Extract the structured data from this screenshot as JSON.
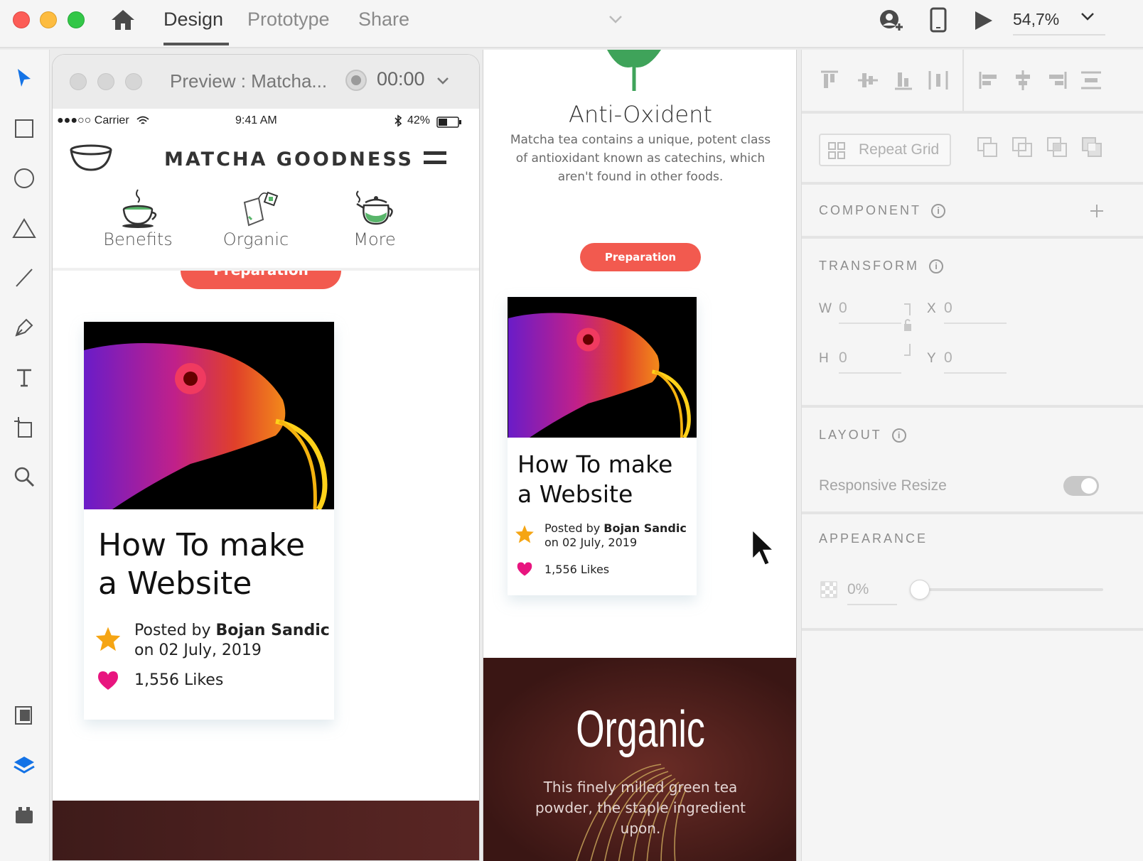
{
  "topbar": {
    "tabs": [
      "Design",
      "Prototype",
      "Share"
    ],
    "active_tab": "Design",
    "zoom": "54,7%"
  },
  "preview": {
    "title": "Preview : Matcha...",
    "timer": "00:00",
    "status": {
      "carrier": "●●●○○ Carrier",
      "time": "9:41 AM",
      "battery": "42%"
    },
    "brand": "MATCHA GOODNESS",
    "nav": [
      "Benefits",
      "Organic",
      "More"
    ],
    "prep_button": "Preparation",
    "card": {
      "title_line1": "How To make",
      "title_line2": "a Website",
      "posted_by": "Posted by",
      "author": "Bojan Sandic",
      "date": "on 02 July, 2019",
      "likes": "1,556 Likes"
    }
  },
  "artboard": {
    "heading": "Anti-Oxident",
    "body": [
      "Matcha tea contains a unique, potent class",
      "of antioxidant known as catechins, which",
      "aren't found in other foods."
    ],
    "prep_button": "Preparation",
    "card": {
      "title_line1": "How To make",
      "title_line2": "a Website",
      "posted_by": "Posted by",
      "author": "Bojan Sandic",
      "date": "on 02 July, 2019",
      "likes": "1,556 Likes"
    },
    "organic": {
      "title": "Organic",
      "line1": "This finely milled green tea",
      "line2": "powder, the staple ingredient",
      "line3": "upon."
    }
  },
  "panel": {
    "repeat_grid": "Repeat Grid",
    "component": "COMPONENT",
    "transform": "TRANSFORM",
    "w_label": "W",
    "w_value": "0",
    "h_label": "H",
    "h_value": "0",
    "x_label": "X",
    "x_value": "0",
    "y_label": "Y",
    "y_value": "0",
    "layout": "LAYOUT",
    "responsive_resize": "Responsive Resize",
    "appearance": "APPEARANCE",
    "opacity": "0%"
  },
  "colors": {
    "accent": "#f25a4f",
    "tool_blue": "#1473e6",
    "heart": "#e8157f",
    "star": "#f5a514",
    "organic_bg": "#4b1d1c"
  }
}
